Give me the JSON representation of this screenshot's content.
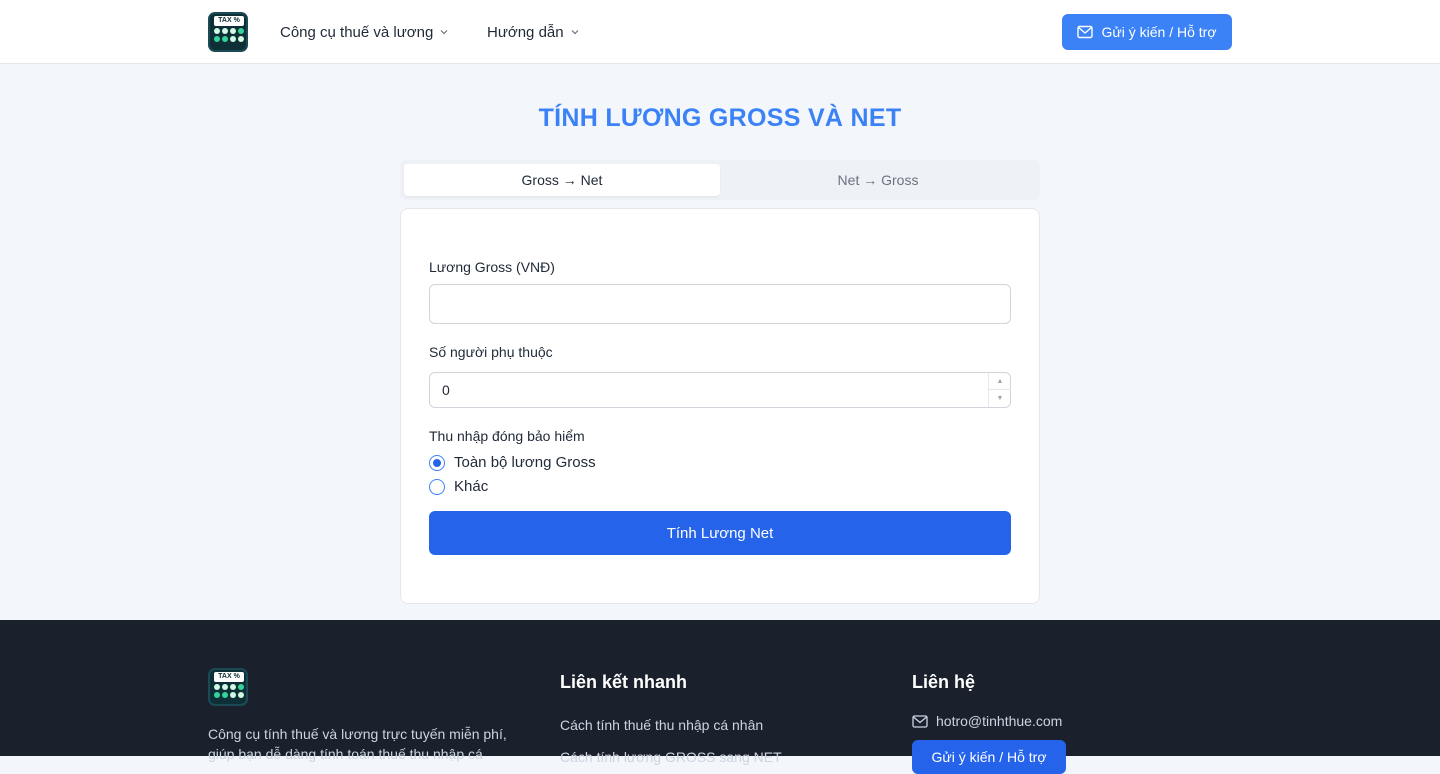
{
  "header": {
    "logo_text": "TAX %",
    "nav": [
      {
        "label": "Công cụ thuế và lương"
      },
      {
        "label": "Hướng dẫn"
      }
    ],
    "support_label": "Gửi ý kiến / Hỗ trợ"
  },
  "page": {
    "title": "TÍNH LƯƠNG GROSS VÀ NET"
  },
  "tabs": [
    {
      "label": "Gross → Net",
      "active": true
    },
    {
      "label": "Net → Gross",
      "active": false
    }
  ],
  "form": {
    "gross_label": "Lương Gross (VNĐ)",
    "gross_value": "",
    "dependents_label": "Số người phụ thuộc",
    "dependents_value": "0",
    "insurance_label": "Thu nhập đóng bảo hiểm",
    "insurance_options": [
      {
        "label": "Toàn bộ lương Gross",
        "checked": true
      },
      {
        "label": "Khác",
        "checked": false
      }
    ],
    "submit_label": "Tính Lương Net"
  },
  "footer": {
    "logo_text": "TAX %",
    "description": "Công cụ tính thuế và lương trực tuyến miễn phí, giúp bạn dễ dàng tính toán thuế thu nhập cá",
    "quick_links_heading": "Liên kết nhanh",
    "quick_links": [
      "Cách tính thuế thu nhập cá nhân",
      "Cách tính lương GROSS sang NET"
    ],
    "contact_heading": "Liên hệ",
    "email": "hotro@tinhthue.com",
    "support_label": "Gửi ý kiến / Hỗ trợ"
  },
  "colors": {
    "accent": "#3b82f6",
    "primary_button": "#2563eb",
    "footer_bg": "#1a202c"
  }
}
